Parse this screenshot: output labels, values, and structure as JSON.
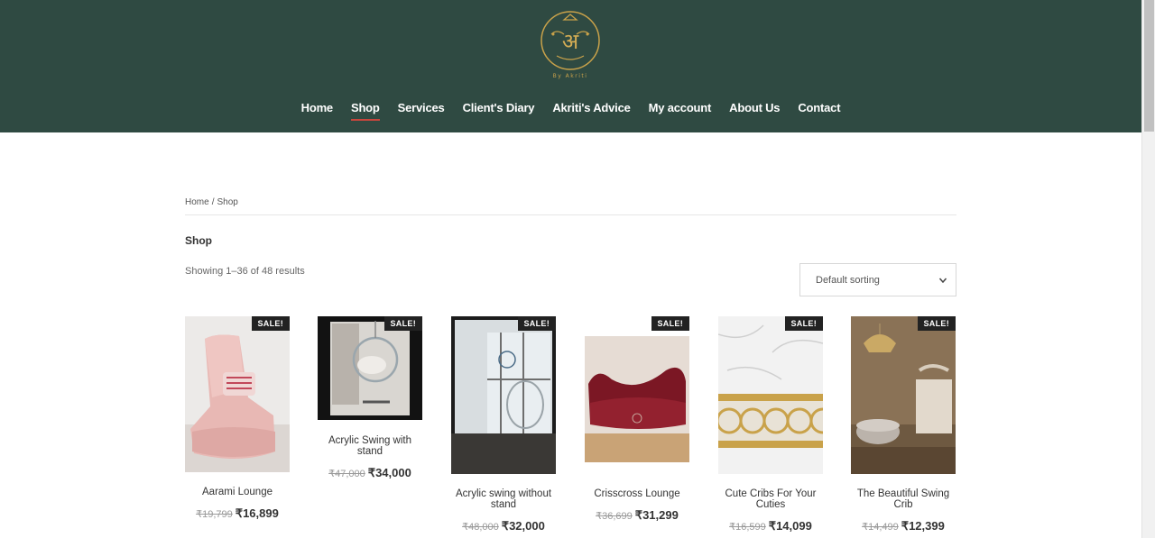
{
  "header": {
    "logo_text": "By Akriti",
    "nav": [
      "Home",
      "Shop",
      "Services",
      "Client's Diary",
      "Akriti's Advice",
      "My account",
      "About Us",
      "Contact"
    ],
    "active_nav": "Shop"
  },
  "breadcrumb": {
    "home": "Home",
    "separator": "/",
    "current": "Shop"
  },
  "page_title": "Shop",
  "result_count": "Showing 1–36 of 48 results",
  "sort": {
    "selected": "Default sorting"
  },
  "sale_label": "SALE!",
  "products": [
    {
      "name": "Aarami Lounge",
      "old_price": "₹19,799",
      "price": "₹16,899"
    },
    {
      "name": "Acrylic Swing with stand",
      "old_price": "₹47,000",
      "price": "₹34,000"
    },
    {
      "name": "Acrylic swing without stand",
      "old_price": "₹48,000",
      "price": "₹32,000"
    },
    {
      "name": "Crisscross Lounge",
      "old_price": "₹36,699",
      "price": "₹31,299"
    },
    {
      "name": "Cute Cribs For Your Cuties",
      "old_price": "₹16,599",
      "price": "₹14,099"
    },
    {
      "name": "The Beautiful Swing Crib",
      "old_price": "₹14,499",
      "price": "₹12,399"
    }
  ],
  "colors": {
    "header_bg": "#2f4a42",
    "active_underline": "#c9463d",
    "badge_bg": "#222222"
  }
}
